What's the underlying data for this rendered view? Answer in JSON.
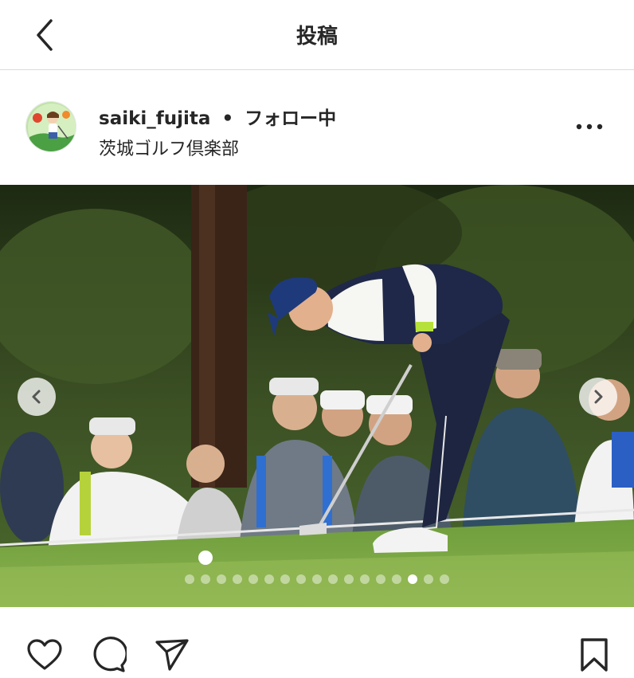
{
  "header": {
    "title": "投稿",
    "back_icon": "chevron-left-icon"
  },
  "post": {
    "username": "saiki_fujita",
    "separator": "•",
    "follow_status": "フォロー中",
    "location": "茨城ゴルフ倶楽部",
    "more_icon": "more-horizontal-icon"
  },
  "carousel": {
    "total": 17,
    "active_index": 14,
    "prev_icon": "chevron-left-icon",
    "next_icon": "chevron-right-icon"
  },
  "actions": {
    "like_icon": "heart-icon",
    "comment_icon": "comment-icon",
    "share_icon": "send-icon",
    "save_icon": "bookmark-icon"
  },
  "colors": {
    "text": "#262626",
    "divider": "#dbdbdb"
  }
}
